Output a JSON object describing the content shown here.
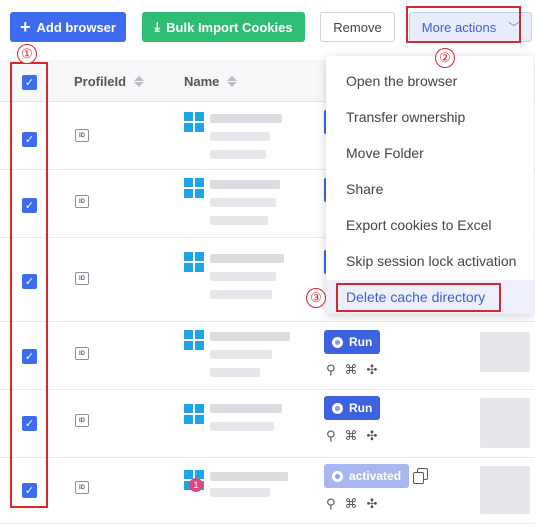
{
  "toolbar": {
    "add_browser": "Add browser",
    "bulk_import": "Bulk Import Cookies",
    "remove": "Remove",
    "more_actions": "More actions"
  },
  "annotations": {
    "one": "①",
    "two": "②",
    "three": "③"
  },
  "table": {
    "col_profile_id": "ProfileId",
    "col_name": "Name"
  },
  "rows": [
    {
      "checked": true,
      "status": ""
    },
    {
      "checked": true,
      "status": ""
    },
    {
      "checked": true,
      "status": ""
    },
    {
      "checked": true,
      "status": "Run"
    },
    {
      "checked": true,
      "status": "Run"
    },
    {
      "checked": true,
      "status": "activated"
    }
  ],
  "row_labels": {
    "run_4": "Run",
    "run_5": "Run",
    "run_6": "activated",
    "badge": "1"
  },
  "menu": {
    "items": [
      "Open the browser",
      "Transfer ownership",
      "Move Folder",
      "Share",
      "Export cookies to Excel",
      "Skip session lock activation",
      "Delete cache directory"
    ],
    "active_index": 6
  },
  "colors": {
    "primary": "#3d6cf0",
    "success": "#2dbd73",
    "annotation": "#d9272e",
    "windows": "#1ea5e6"
  }
}
